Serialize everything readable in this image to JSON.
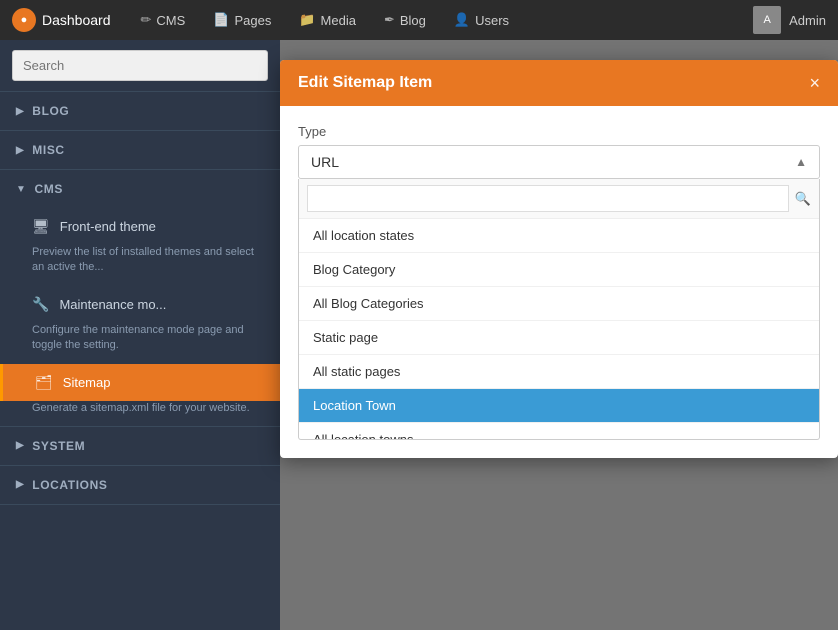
{
  "navbar": {
    "brand": "Dashboard",
    "brand_icon": "●",
    "items": [
      {
        "label": "CMS",
        "icon": "✏"
      },
      {
        "label": "Pages",
        "icon": "📄"
      },
      {
        "label": "Media",
        "icon": "📁"
      },
      {
        "label": "Blog",
        "icon": "✒"
      },
      {
        "label": "Users",
        "icon": "👤"
      },
      {
        "label": "⬆",
        "icon": ""
      }
    ],
    "admin_label": "Admin"
  },
  "sidebar": {
    "search_placeholder": "Search",
    "sections": [
      {
        "id": "blog",
        "label": "BLOG",
        "expanded": false
      },
      {
        "id": "misc",
        "label": "MISC",
        "expanded": false
      },
      {
        "id": "cms",
        "label": "CMS",
        "expanded": true,
        "items": [
          {
            "id": "frontend-theme",
            "icon": "🖥",
            "label": "Front-end theme",
            "desc": "Preview the list of installed themes and select an active the..."
          },
          {
            "id": "maintenance-mode",
            "icon": "🔧",
            "label": "Maintenance mo...",
            "desc": "Configure the maintenance mode page and toggle the setting."
          },
          {
            "id": "sitemap",
            "icon": "🗂",
            "label": "Sitemap",
            "desc": "Generate a sitemap.xml file for your website.",
            "active": true
          }
        ]
      },
      {
        "id": "system",
        "label": "SYSTEM",
        "expanded": false
      },
      {
        "id": "locations",
        "label": "LOCATIONS",
        "expanded": false
      }
    ]
  },
  "modal": {
    "title": "Edit Sitemap Item",
    "close_label": "×",
    "form": {
      "type_label": "Type",
      "type_value": "URL",
      "search_placeholder": ""
    },
    "dropdown_items": [
      {
        "label": "All location states",
        "active": false
      },
      {
        "label": "Blog Category",
        "active": false
      },
      {
        "label": "All Blog Categories",
        "active": false
      },
      {
        "label": "Static page",
        "active": false
      },
      {
        "label": "All static pages",
        "active": false
      },
      {
        "label": "Location Town",
        "active": true
      },
      {
        "label": "All location towns",
        "active": false
      }
    ]
  }
}
